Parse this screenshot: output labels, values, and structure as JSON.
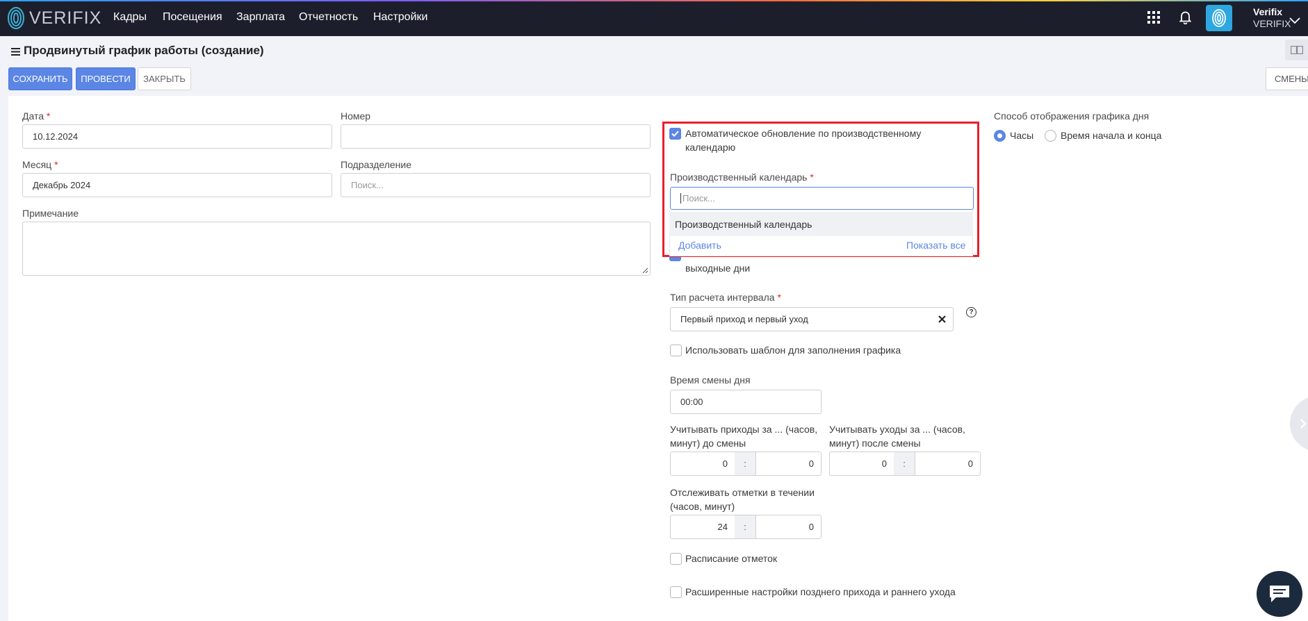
{
  "nav": {
    "logo_text": "VERIFIX",
    "items": [
      "Кадры",
      "Посещения",
      "Зарплата",
      "Отчетность",
      "Настройки"
    ],
    "user_name": "Verifix",
    "user_org": "VERIFIX"
  },
  "header": {
    "title": "Продвинутый график работы (создание)",
    "save_label": "СОХРАНИТЬ",
    "post_label": "ПРОВЕСТИ",
    "close_label": "ЗАКРЫТЬ",
    "shifts_label": "СМЕНЫ"
  },
  "form": {
    "date_label": "Дата",
    "date_value": "10.12.2024",
    "number_label": "Номер",
    "number_value": "",
    "month_label": "Месяц",
    "month_value": "Декабрь 2024",
    "division_label": "Подразделение",
    "division_placeholder": "Поиск...",
    "note_label": "Примечание",
    "auto_update_label_1": "Автоматическое обновление по производственному",
    "auto_update_label_2": "календарю",
    "prod_calendar_label": "Производственный календарь",
    "prod_calendar_placeholder": "Поиск...",
    "dropdown_item": "Производственный календарь",
    "dropdown_add": "Добавить",
    "dropdown_show_all": "Показать все",
    "hidden_checkbox_label": "выходные дни",
    "interval_type_label": "Тип расчета интервала",
    "interval_type_value": "Первый приход и первый уход",
    "use_template_label": "Использовать шаблон для заполнения графика",
    "day_shift_time_label": "Время смены дня",
    "day_shift_time_value": "00:00",
    "arrivals_label_1": "Учитывать приходы за ... (часов,",
    "arrivals_label_2": "минут) до смены",
    "arrivals_hours": "0",
    "arrivals_minutes": "0",
    "departures_label_1": "Учитывать уходы за ... (часов,",
    "departures_label_2": "минут) после смены",
    "departures_hours": "0",
    "departures_minutes": "0",
    "track_label_1": "Отслеживать отметки в течении",
    "track_label_2": "(часов, минут)",
    "track_hours": "24",
    "track_minutes": "0",
    "marks_schedule_label": "Расписание отметок",
    "advanced_label": "Расширенные настройки позднего прихода и раннего ухода",
    "display_mode_label": "Способ отображения графика дня",
    "display_hours": "Часы",
    "display_start_end": "Время начала и конца",
    "colon": ":"
  },
  "colors": {
    "navbar": "#1c1f2b",
    "accent": "#5b86e5",
    "highlight": "#e8202a"
  }
}
